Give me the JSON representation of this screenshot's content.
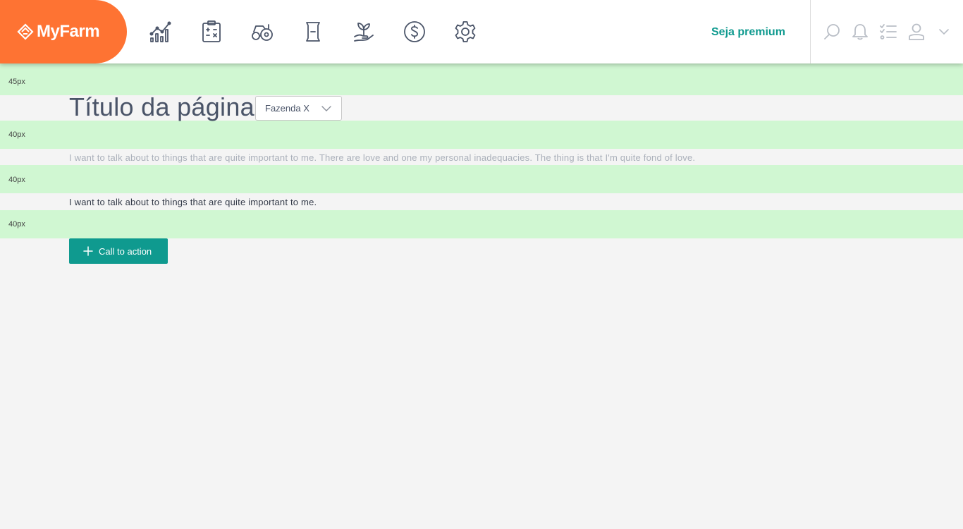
{
  "brand": {
    "name": "MyFarm",
    "color": "#fe7333"
  },
  "nav": {
    "items": [
      {
        "icon": "chart-icon"
      },
      {
        "icon": "calculator-clipboard-icon"
      },
      {
        "icon": "tractor-icon"
      },
      {
        "icon": "scroll-icon"
      },
      {
        "icon": "plant-hand-icon"
      },
      {
        "icon": "dollar-icon"
      },
      {
        "icon": "gear-icon"
      }
    ]
  },
  "header": {
    "premium_label": "Seja premium",
    "accent": "#0f9a8f",
    "tools": [
      "search-icon",
      "bell-icon",
      "checklist-icon",
      "user-icon",
      "chevron-down-icon"
    ]
  },
  "guides": {
    "g1": "45px",
    "g2": "40px",
    "g3": "40px",
    "g4": "40px"
  },
  "page": {
    "title": "Título da página",
    "farm_select": {
      "value": "Fazenda X"
    },
    "paragraph_muted": "I want to talk about to things that are quite important to me. There are love and one my personal inadequacies. The thing is that I'm quite fond of love.",
    "paragraph": "I want to talk about to things that are quite important to me.",
    "cta_label": "Call to action"
  }
}
